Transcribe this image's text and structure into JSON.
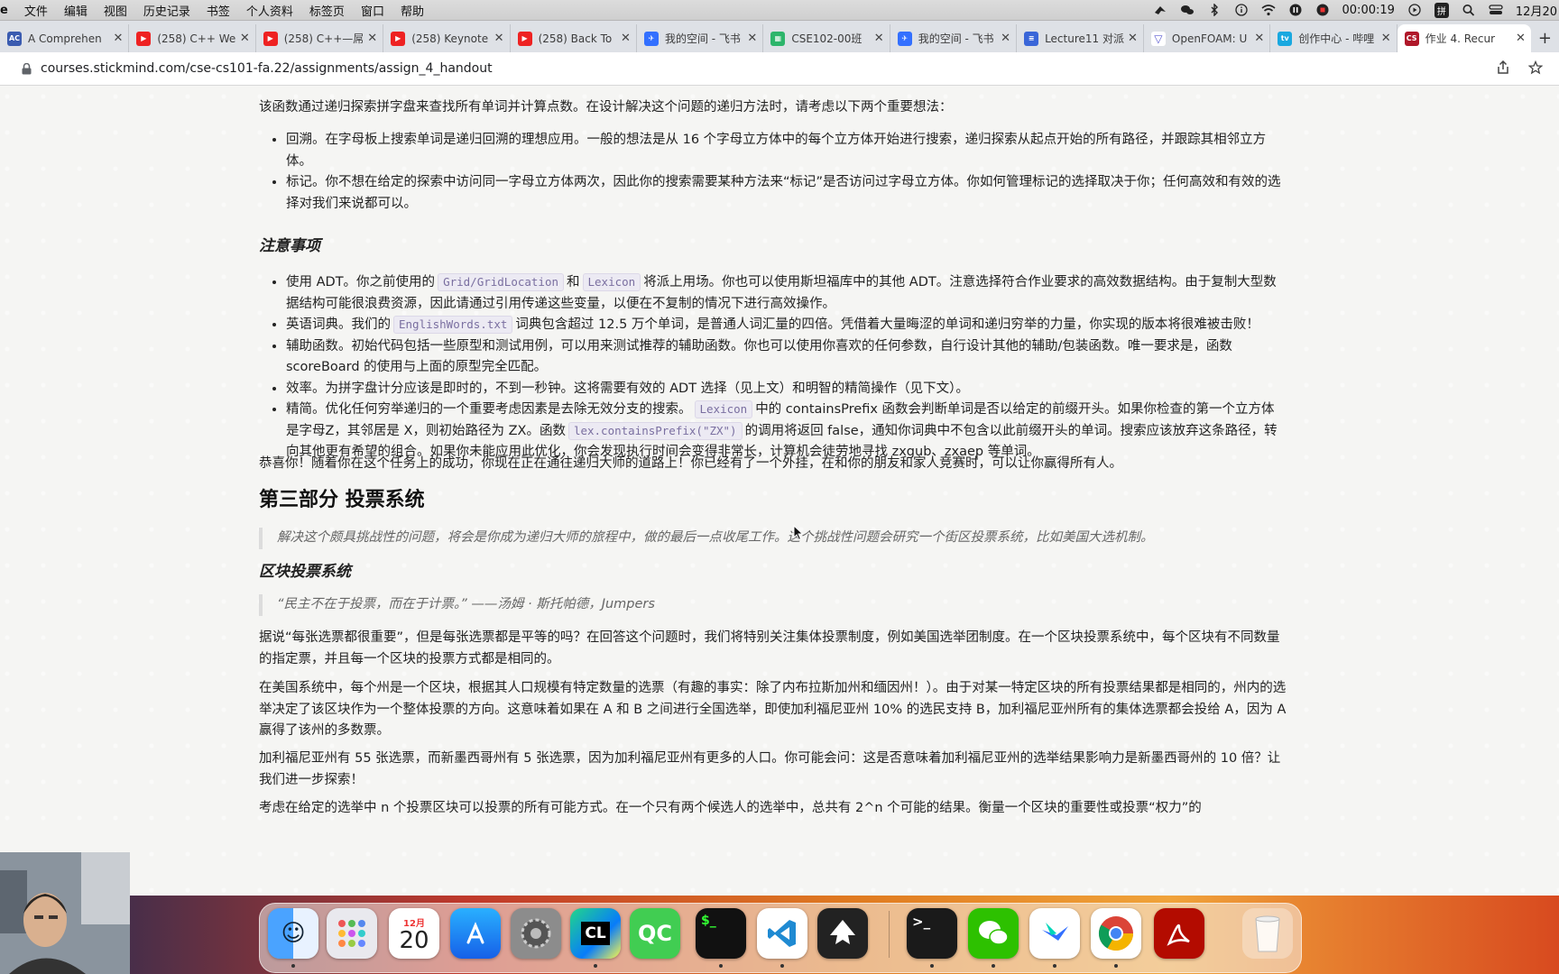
{
  "menubar": {
    "app": "e",
    "items": [
      "文件",
      "编辑",
      "视图",
      "历史记录",
      "书签",
      "个人资料",
      "标签页",
      "窗口",
      "帮助"
    ],
    "timer": "00:00:19",
    "input_badge": "拼",
    "date": "12月20"
  },
  "tabs": [
    {
      "title": "A Comprehen",
      "color": "#3a5bb0",
      "glyph": "AC"
    },
    {
      "title": "(258) C++ We",
      "color": "#e22",
      "glyph": "▶"
    },
    {
      "title": "(258) C++—屌",
      "color": "#e22",
      "glyph": "▶"
    },
    {
      "title": "(258) Keynote",
      "color": "#e22",
      "glyph": "▶"
    },
    {
      "title": "(258) Back To",
      "color": "#e22",
      "glyph": "▶"
    },
    {
      "title": "我的空间 - 飞书",
      "color": "#3370ff",
      "glyph": "✈"
    },
    {
      "title": "CSE102-00班",
      "color": "#2db56b",
      "glyph": "▦"
    },
    {
      "title": "我的空间 - 飞书",
      "color": "#3370ff",
      "glyph": "✈"
    },
    {
      "title": "Lecture11 对派",
      "color": "#3a66d8",
      "glyph": "≡"
    },
    {
      "title": "OpenFOAM: U",
      "color": "#5a5ad0",
      "glyph": "▽"
    },
    {
      "title": "创作中心 - 哔哩",
      "color": "#19a8e0",
      "glyph": "tv"
    },
    {
      "title": "作业 4. Recur",
      "color": "#b0182a",
      "glyph": "CS"
    }
  ],
  "address": {
    "url": "courses.stickmind.com/cse-cs101-fa.22/assignments/assign_4_handout"
  },
  "doc": {
    "intro": "该函数通过递归探索拼字盘来查找所有单词并计算点数。在设计解决这个问题的递归方法时，请考虑以下两个重要想法：",
    "ideas": [
      "回溯。在字母板上搜索单词是递归回溯的理想应用。一般的想法是从 16 个字母立方体中的每个立方体开始进行搜索，递归探索从起点开始的所有路径，并跟踪其相邻立方体。",
      "标记。你不想在给定的探索中访问同一字母立方体两次，因此你的搜索需要某种方法来“标记”是否访问过字母立方体。你如何管理标记的选择取决于你；任何高效和有效的选择对我们来说都可以。"
    ],
    "notes_heading": "注意事项",
    "note1": {
      "a": "使用 ADT。你之前使用的",
      "code1": "Grid/GridLocation",
      "b": "和",
      "code2": "Lexicon",
      "c": "将派上用场。你也可以使用斯坦福库中的其他 ADT。注意选择符合作业要求的高效数据结构。由于复制大型数据结构可能很浪费资源，因此请通过引用传递这些变量，以便在不复制的情况下进行高效操作。"
    },
    "note2": {
      "a": "英语词典。我们的",
      "code1": "EnglishWords.txt",
      "b": "词典包含超过 12.5 万个单词，是普通人词汇量的四倍。凭借着大量晦涩的单词和递归穷举的力量，你实现的版本将很难被击败！"
    },
    "note3": "辅助函数。初始代码包括一些原型和测试用例，可以用来测试推荐的辅助函数。你也可以使用你喜欢的任何参数，自行设计其他的辅助/包装函数。唯一要求是，函数 scoreBoard 的使用与上面的原型完全匹配。",
    "note4": "效率。为拼字盘计分应该是即时的，不到一秒钟。这将需要有效的 ADT 选择（见上文）和明智的精简操作（见下文）。",
    "note5": {
      "a": "精简。优化任何穷举递归的一个重要考虑因素是去除无效分支的搜索。",
      "code1": "Lexicon",
      "b": "中的 containsPrefix 函数会判断单词是否以给定的前缀开头。如果你检查的第一个立方体是字母Z，其邻居是 X，则初始路径为 ZX。函数",
      "code2": "lex.containsPrefix(\"ZX\")",
      "c": "的调用将返回 false，通知你词典中不包含以此前缀开头的单词。搜索应该放弃这条路径，转向其他更有希望的组合。如果你未能应用此优化，你会发现执行时间会变得非常长，计算机会徒劳地寻找 zxgub、zxaep 等单词。"
    },
    "congrats": "恭喜你！随着你在这个任务上的成功，你现在正在通往递归大师的道路上！你已经有了一个外挂，在和你的朋友和家人竞赛时，可以让你赢得所有人。",
    "part3_title": "第三部分 投票系统",
    "part3_quote": "解决这个颇具挑战性的问题，将会是你成为递归大师的旅程中，做的最后一点收尾工作。这个挑战性问题会研究一个街区投票系统，比如美国大选机制。",
    "block_heading": "区块投票系统",
    "block_quote": "“民主不在于投票，而在于计票。” ——汤姆 · 斯托帕德，Jumpers",
    "para1": "据说“每张选票都很重要”，但是每张选票都是平等的吗？在回答这个问题时，我们将特别关注集体投票制度，例如美国选举团制度。在一个区块投票系统中，每个区块有不同数量的指定票，并且每一个区块的投票方式都是相同的。",
    "para2": "在美国系统中，每个州是一个区块，根据其人口规模有特定数量的选票（有趣的事实：除了内布拉斯加州和缅因州！）。由于对某一特定区块的所有投票结果都是相同的，州内的选举决定了该区块作为一个整体投票的方向。这意味着如果在 A 和 B 之间进行全国选举，即使加利福尼亚州 10% 的选民支持 B，加利福尼亚州所有的集体选票都会投给 A，因为 A 赢得了该州的多数票。",
    "para3": "加利福尼亚州有 55 张选票，而新墨西哥州有 5 张选票，因为加利福尼亚州有更多的人口。你可能会问：这是否意味着加利福尼亚州的选举结果影响力是新墨西哥州的 10 倍？让我们进一步探索！",
    "para4": "考虑在给定的选举中 n 个投票区块可以投票的所有可能方式。在一个只有两个候选人的选举中，总共有 2^n 个可能的结果。衡量一个区块的重要性或投票“权力”的"
  },
  "dock": {
    "calendar_month": "12月",
    "calendar_day": "20",
    "clion": "CL",
    "qt": "QC",
    "terminal": "$_",
    "terminal2": ">_"
  }
}
